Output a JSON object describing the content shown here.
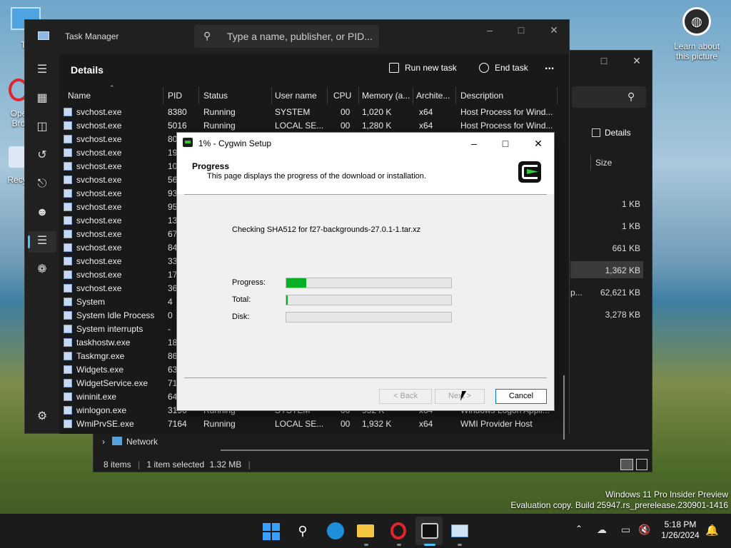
{
  "desktop": {
    "icons": [
      {
        "label": "Th"
      },
      {
        "label": "Ope\nBro"
      },
      {
        "label": "Recy"
      }
    ],
    "spotlight_label": "Learn about\nthis picture",
    "watermark_line1": "Windows 11 Pro Insider Preview",
    "watermark_line2": "Evaluation copy. Build 25947.rs_prerelease.230901-1416"
  },
  "explorer": {
    "details_button": "Details",
    "size_header": "Size",
    "sizes": [
      "1 KB",
      "1 KB",
      "661 KB",
      "1,362 KB",
      "62,621 KB",
      "3,278 KB"
    ],
    "partial_text": "p...",
    "nav_network": "Network",
    "status_items": "8 items",
    "status_selected": "1 item selected",
    "status_size": "1.32 MB"
  },
  "taskmanager": {
    "title": "Task Manager",
    "search_placeholder": "Type a name, publisher, or PID...",
    "page_title": "Details",
    "run_new_task": "Run new task",
    "end_task": "End task",
    "more": "...",
    "columns": [
      "Name",
      "PID",
      "Status",
      "User name",
      "CPU",
      "Memory (a...",
      "Archite...",
      "Description"
    ],
    "rows": [
      {
        "name": "svchost.exe",
        "pid": "8380",
        "status": "Running",
        "user": "SYSTEM",
        "cpu": "00",
        "mem": "1,020 K",
        "arch": "x64",
        "desc": "Host Process for Wind..."
      },
      {
        "name": "svchost.exe",
        "pid": "5016",
        "status": "Running",
        "user": "LOCAL SE...",
        "cpu": "00",
        "mem": "1,280 K",
        "arch": "x64",
        "desc": "Host Process for Wind..."
      },
      {
        "name": "svchost.exe",
        "pid": "80",
        "status": "",
        "user": "",
        "cpu": "",
        "mem": "",
        "arch": "",
        "desc": ""
      },
      {
        "name": "svchost.exe",
        "pid": "19",
        "status": "",
        "user": "",
        "cpu": "",
        "mem": "",
        "arch": "",
        "desc": ""
      },
      {
        "name": "svchost.exe",
        "pid": "10",
        "status": "",
        "user": "",
        "cpu": "",
        "mem": "",
        "arch": "",
        "desc": ""
      },
      {
        "name": "svchost.exe",
        "pid": "56",
        "status": "",
        "user": "",
        "cpu": "",
        "mem": "",
        "arch": "",
        "desc": ""
      },
      {
        "name": "svchost.exe",
        "pid": "93",
        "status": "",
        "user": "",
        "cpu": "",
        "mem": "",
        "arch": "",
        "desc": ""
      },
      {
        "name": "svchost.exe",
        "pid": "95",
        "status": "",
        "user": "",
        "cpu": "",
        "mem": "",
        "arch": "",
        "desc": ""
      },
      {
        "name": "svchost.exe",
        "pid": "13",
        "status": "",
        "user": "",
        "cpu": "",
        "mem": "",
        "arch": "",
        "desc": ""
      },
      {
        "name": "svchost.exe",
        "pid": "67",
        "status": "",
        "user": "",
        "cpu": "",
        "mem": "",
        "arch": "",
        "desc": ""
      },
      {
        "name": "svchost.exe",
        "pid": "84",
        "status": "",
        "user": "",
        "cpu": "",
        "mem": "",
        "arch": "",
        "desc": ""
      },
      {
        "name": "svchost.exe",
        "pid": "33",
        "status": "",
        "user": "",
        "cpu": "",
        "mem": "",
        "arch": "",
        "desc": ""
      },
      {
        "name": "svchost.exe",
        "pid": "17",
        "status": "",
        "user": "",
        "cpu": "",
        "mem": "",
        "arch": "",
        "desc": ""
      },
      {
        "name": "svchost.exe",
        "pid": "36",
        "status": "",
        "user": "",
        "cpu": "",
        "mem": "",
        "arch": "",
        "desc": ""
      },
      {
        "name": "System",
        "pid": "4",
        "status": "",
        "user": "",
        "cpu": "",
        "mem": "",
        "arch": "",
        "desc": ""
      },
      {
        "name": "System Idle Process",
        "pid": "0",
        "status": "",
        "user": "",
        "cpu": "",
        "mem": "",
        "arch": "",
        "desc": ""
      },
      {
        "name": "System interrupts",
        "pid": "-",
        "status": "",
        "user": "",
        "cpu": "",
        "mem": "",
        "arch": "",
        "desc": ""
      },
      {
        "name": "taskhostw.exe",
        "pid": "18",
        "status": "",
        "user": "",
        "cpu": "",
        "mem": "",
        "arch": "",
        "desc": ""
      },
      {
        "name": "Taskmgr.exe",
        "pid": "86",
        "status": "",
        "user": "",
        "cpu": "",
        "mem": "",
        "arch": "",
        "desc": ""
      },
      {
        "name": "Widgets.exe",
        "pid": "63",
        "status": "",
        "user": "",
        "cpu": "",
        "mem": "",
        "arch": "",
        "desc": ""
      },
      {
        "name": "WidgetService.exe",
        "pid": "71",
        "status": "",
        "user": "",
        "cpu": "",
        "mem": "",
        "arch": "",
        "desc": ""
      },
      {
        "name": "wininit.exe",
        "pid": "64",
        "status": "",
        "user": "",
        "cpu": "",
        "mem": "",
        "arch": "",
        "desc": ""
      },
      {
        "name": "winlogon.exe",
        "pid": "3196",
        "status": "Running",
        "user": "SYSTEM",
        "cpu": "00",
        "mem": "932 K",
        "arch": "x64",
        "desc": "Windows Logon Appli..."
      },
      {
        "name": "WmiPrvSE.exe",
        "pid": "7164",
        "status": "Running",
        "user": "LOCAL SE...",
        "cpu": "00",
        "mem": "1,932 K",
        "arch": "x64",
        "desc": "WMI Provider Host"
      }
    ]
  },
  "cygwin": {
    "title": "1% - Cygwin Setup",
    "header_title": "Progress",
    "header_sub": "This page displays the progress of the download or installation.",
    "status_line": "Checking SHA512 for f27-backgrounds-27.0.1-1.tar.xz",
    "label_progress": "Progress:",
    "label_total": "Total:",
    "label_disk": "Disk:",
    "progress_fraction": 0.12,
    "total_fraction": 0.005,
    "disk_fraction": 0,
    "btn_back": "< Back",
    "btn_next": "Next >",
    "btn_cancel": "Cancel",
    "accent": "#06b025"
  },
  "taskbar": {
    "time": "5:18 PM",
    "date": "1/26/2024",
    "icons": [
      "windows-start-icon",
      "search-icon",
      "edge-icon",
      "file-explorer-icon",
      "opera-icon",
      "cygwin-icon",
      "taskmanager-icon"
    ]
  }
}
